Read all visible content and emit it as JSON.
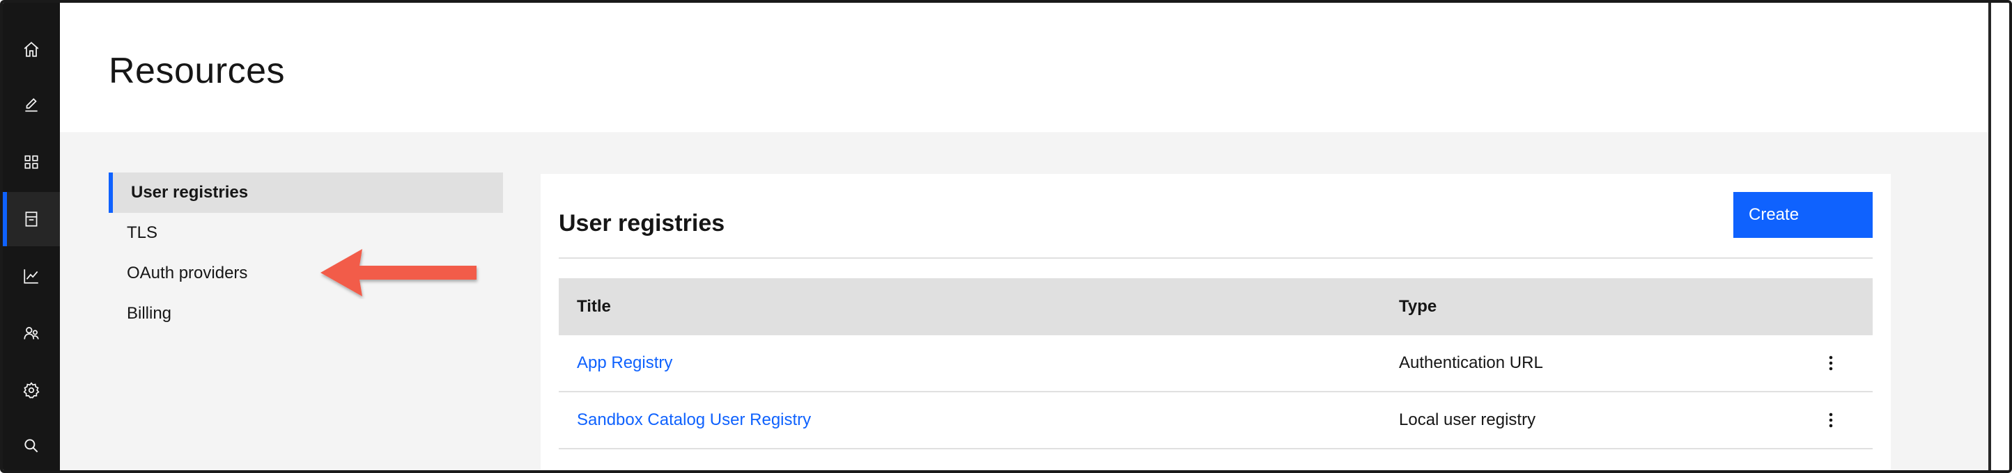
{
  "header": {
    "title": "Resources"
  },
  "rail": {
    "items": [
      {
        "icon": "home-icon",
        "active": false
      },
      {
        "icon": "edit-icon",
        "active": false
      },
      {
        "icon": "apps-grid-icon",
        "active": false
      },
      {
        "icon": "resources-icon",
        "active": true
      },
      {
        "icon": "analytics-icon",
        "active": false
      },
      {
        "icon": "members-icon",
        "active": false
      },
      {
        "icon": "settings-icon",
        "active": false
      },
      {
        "icon": "search-icon",
        "active": false
      }
    ]
  },
  "subnav": {
    "items": [
      {
        "label": "User registries",
        "selected": true
      },
      {
        "label": "TLS",
        "selected": false
      },
      {
        "label": "OAuth providers",
        "selected": false
      },
      {
        "label": "Billing",
        "selected": false
      }
    ]
  },
  "card": {
    "title": "User registries",
    "create_label": "Create",
    "columns": {
      "title": "Title",
      "type": "Type"
    },
    "rows": [
      {
        "title": "App Registry",
        "type": "Authentication URL"
      },
      {
        "title": "Sandbox Catalog User Registry",
        "type": "Local user registry"
      }
    ]
  },
  "colors": {
    "accent": "#0f62fe",
    "rail_bg": "#161616",
    "annotation_arrow": "#f25c4a"
  }
}
